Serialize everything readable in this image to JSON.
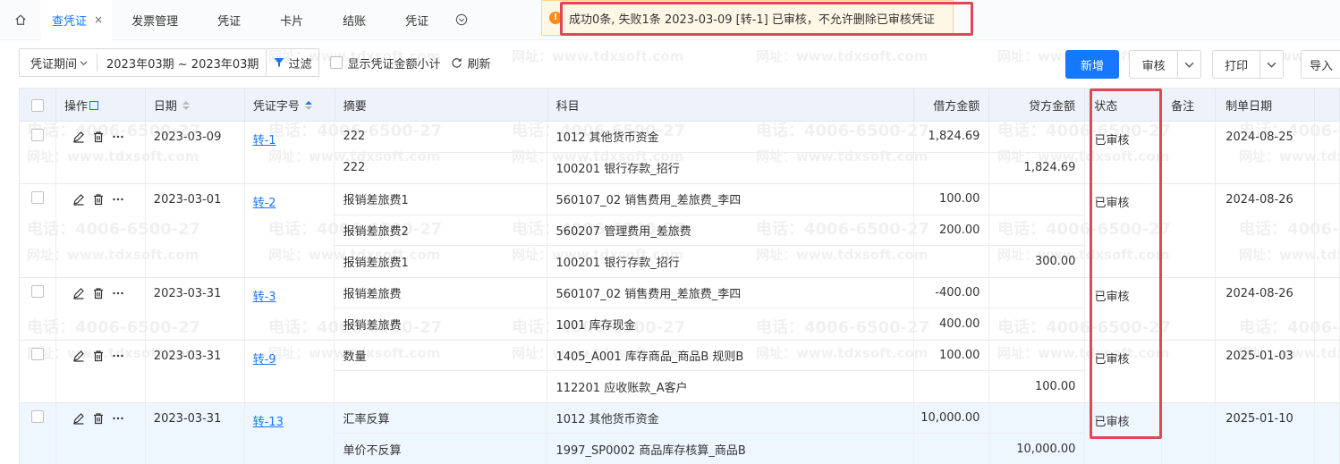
{
  "watermark": {
    "line1": "电话：4006-6500-27",
    "line2": "网址：www.tdxsoft.com"
  },
  "tabs": [
    {
      "label": "查凭证",
      "active": true
    },
    {
      "label": "发票管理"
    },
    {
      "label": "凭证"
    },
    {
      "label": "卡片"
    },
    {
      "label": "结账"
    },
    {
      "label": "凭证"
    }
  ],
  "tab_close": "×",
  "toast": {
    "icon": "!",
    "message": "成功0条, 失败1条 2023-03-09 [转-1] 已审核，不允许删除已审核凭证"
  },
  "toolbar": {
    "period_label": "凭证期间",
    "period_range": "2023年03期 ~ 2023年03期",
    "filter": "过滤",
    "show_subtotal": "显示凭证金额小计",
    "refresh": "刷新"
  },
  "buttons": {
    "add": "新增",
    "audit": "审核",
    "print": "打印",
    "import": "导入"
  },
  "columns": {
    "op": "操作",
    "date": "日期",
    "voucher_no": "凭证字号",
    "summary": "摘要",
    "subject": "科目",
    "debit": "借方金额",
    "credit": "贷方金额",
    "status": "状态",
    "note": "备注",
    "created": "制单日期"
  },
  "vouchers": [
    {
      "date": "2023-03-09",
      "no": "转-1",
      "status": "已审核",
      "created": "2024-08-25",
      "highlighted": false,
      "lines": [
        {
          "summary": "222",
          "subject": "1012 其他货币资金",
          "debit": "1,824.69",
          "credit": ""
        },
        {
          "summary": "222",
          "subject": "100201 银行存款_招行",
          "debit": "",
          "credit": "1,824.69"
        }
      ]
    },
    {
      "date": "2023-03-01",
      "no": "转-2",
      "status": "已审核",
      "created": "2024-08-26",
      "highlighted": false,
      "lines": [
        {
          "summary": "报销差旅费1",
          "subject": "560107_02 销售费用_差旅费_李四",
          "debit": "100.00",
          "credit": ""
        },
        {
          "summary": "报销差旅费2",
          "subject": "560207 管理费用_差旅费",
          "debit": "200.00",
          "credit": ""
        },
        {
          "summary": "报销差旅费1",
          "subject": "100201 银行存款_招行",
          "debit": "",
          "credit": "300.00"
        }
      ]
    },
    {
      "date": "2023-03-31",
      "no": "转-3",
      "status": "已审核",
      "created": "2024-08-26",
      "highlighted": false,
      "lines": [
        {
          "summary": "报销差旅费",
          "subject": "560107_02 销售费用_差旅费_李四",
          "debit": "-400.00",
          "credit": ""
        },
        {
          "summary": "报销差旅费",
          "subject": "1001 库存现金",
          "debit": "400.00",
          "credit": ""
        }
      ]
    },
    {
      "date": "2023-03-31",
      "no": "转-9",
      "status": "已审核",
      "created": "2025-01-03",
      "highlighted": false,
      "lines": [
        {
          "summary": "数量",
          "subject": "1405_A001 库存商品_商品B 规则B",
          "debit": "100.00",
          "credit": ""
        },
        {
          "summary": "",
          "subject": "112201 应收账款_A客户",
          "debit": "",
          "credit": "100.00"
        }
      ]
    },
    {
      "date": "2023-03-31",
      "no": "转-13",
      "status": "已审核",
      "created": "2025-01-10",
      "highlighted": true,
      "lines": [
        {
          "summary": "汇率反算",
          "subject": "1012 其他货币资金",
          "debit": "10,000.00",
          "credit": ""
        },
        {
          "summary": "单价不反算",
          "subject": "1997_SP0002 商品库存核算_商品B",
          "debit": "",
          "credit": "10,000.00"
        }
      ]
    }
  ]
}
